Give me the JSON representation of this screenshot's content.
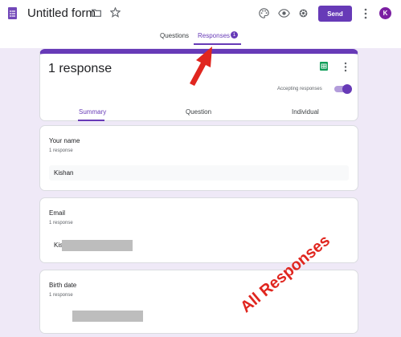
{
  "header": {
    "title": "Untitled form",
    "send_label": "Send",
    "avatar_initial": "K",
    "tabs": {
      "questions": "Questions",
      "responses": "Responses",
      "badge": "1"
    }
  },
  "summary_card": {
    "response_count": "1 response",
    "accepting_label": "Accepting responses",
    "accepting": true,
    "subtabs": {
      "summary": "Summary",
      "question": "Question",
      "individual": "Individual"
    }
  },
  "questions": [
    {
      "title": "Your name",
      "sub": "1 response",
      "answer": "Kishan"
    },
    {
      "title": "Email",
      "sub": "1 response",
      "answer": "Kis"
    },
    {
      "title": "Birth date",
      "sub": "1 response",
      "answer": ""
    }
  ],
  "annotation": {
    "text": "All Responses",
    "color": "#e0261f"
  },
  "colors": {
    "accent": "#673ab7",
    "background": "#efe9f7"
  },
  "icons": [
    "form-icon",
    "folder-icon",
    "star-icon",
    "palette-icon",
    "eye-icon",
    "gear-icon",
    "more-vert-icon",
    "sheets-icon"
  ]
}
